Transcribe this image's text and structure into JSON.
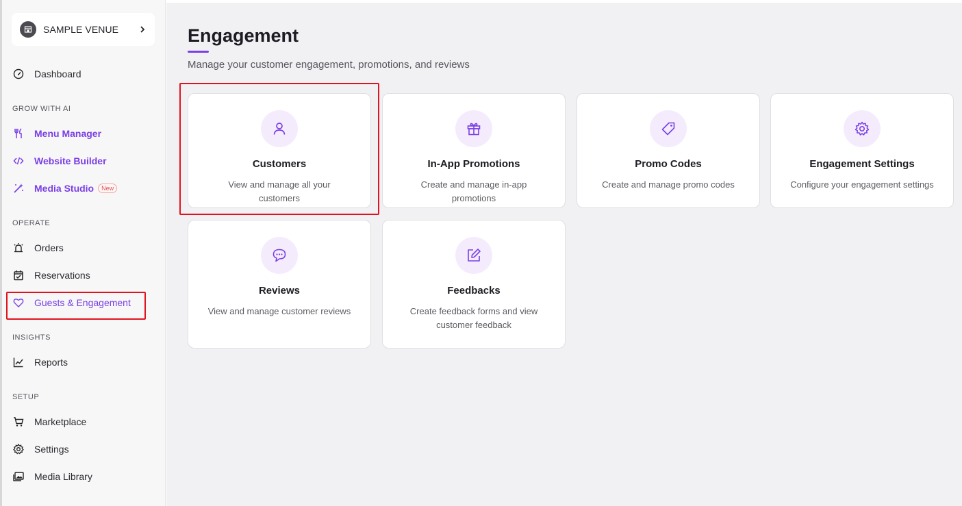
{
  "venue": {
    "name": "SAMPLE VENUE"
  },
  "sidebar": {
    "dashboard": "Dashboard",
    "sections": {
      "grow": "GROW WITH AI",
      "operate": "OPERATE",
      "insights": "INSIGHTS",
      "setup": "SETUP"
    },
    "grow_items": [
      {
        "label": "Menu Manager",
        "icon": "fork-knife-icon"
      },
      {
        "label": "Website Builder",
        "icon": "code-icon"
      },
      {
        "label": "Media Studio",
        "icon": "magic-wand-icon",
        "badge": "New"
      }
    ],
    "operate_items": [
      {
        "label": "Orders",
        "icon": "bell-alarm-icon"
      },
      {
        "label": "Reservations",
        "icon": "calendar-check-icon"
      },
      {
        "label": "Guests & Engagement",
        "icon": "heart-icon",
        "active": true
      }
    ],
    "insights_items": [
      {
        "label": "Reports",
        "icon": "line-chart-icon"
      }
    ],
    "setup_items": [
      {
        "label": "Marketplace",
        "icon": "cart-icon"
      },
      {
        "label": "Settings",
        "icon": "gear-icon"
      },
      {
        "label": "Media Library",
        "icon": "images-icon"
      }
    ]
  },
  "main": {
    "title": "Engagement",
    "subtitle": "Manage your customer engagement, promotions, and reviews",
    "cards": [
      {
        "title": "Customers",
        "description": "View and manage all your customers",
        "icon": "user-icon"
      },
      {
        "title": "In-App Promotions",
        "description": "Create and manage in-app promotions",
        "icon": "gift-icon"
      },
      {
        "title": "Promo Codes",
        "description": "Create and manage promo codes",
        "icon": "tag-icon"
      },
      {
        "title": "Engagement Settings",
        "description": "Configure your engagement settings",
        "icon": "gear-icon"
      },
      {
        "title": "Reviews",
        "description": "View and manage customer reviews",
        "icon": "chat-bubbles-icon"
      },
      {
        "title": "Feedbacks",
        "description": "Create feedback forms and view customer feedback",
        "icon": "edit-icon"
      }
    ]
  },
  "colors": {
    "accent": "#7b3fe4",
    "highlight": "#e0141e",
    "icon_bg": "#f4ecfd"
  }
}
